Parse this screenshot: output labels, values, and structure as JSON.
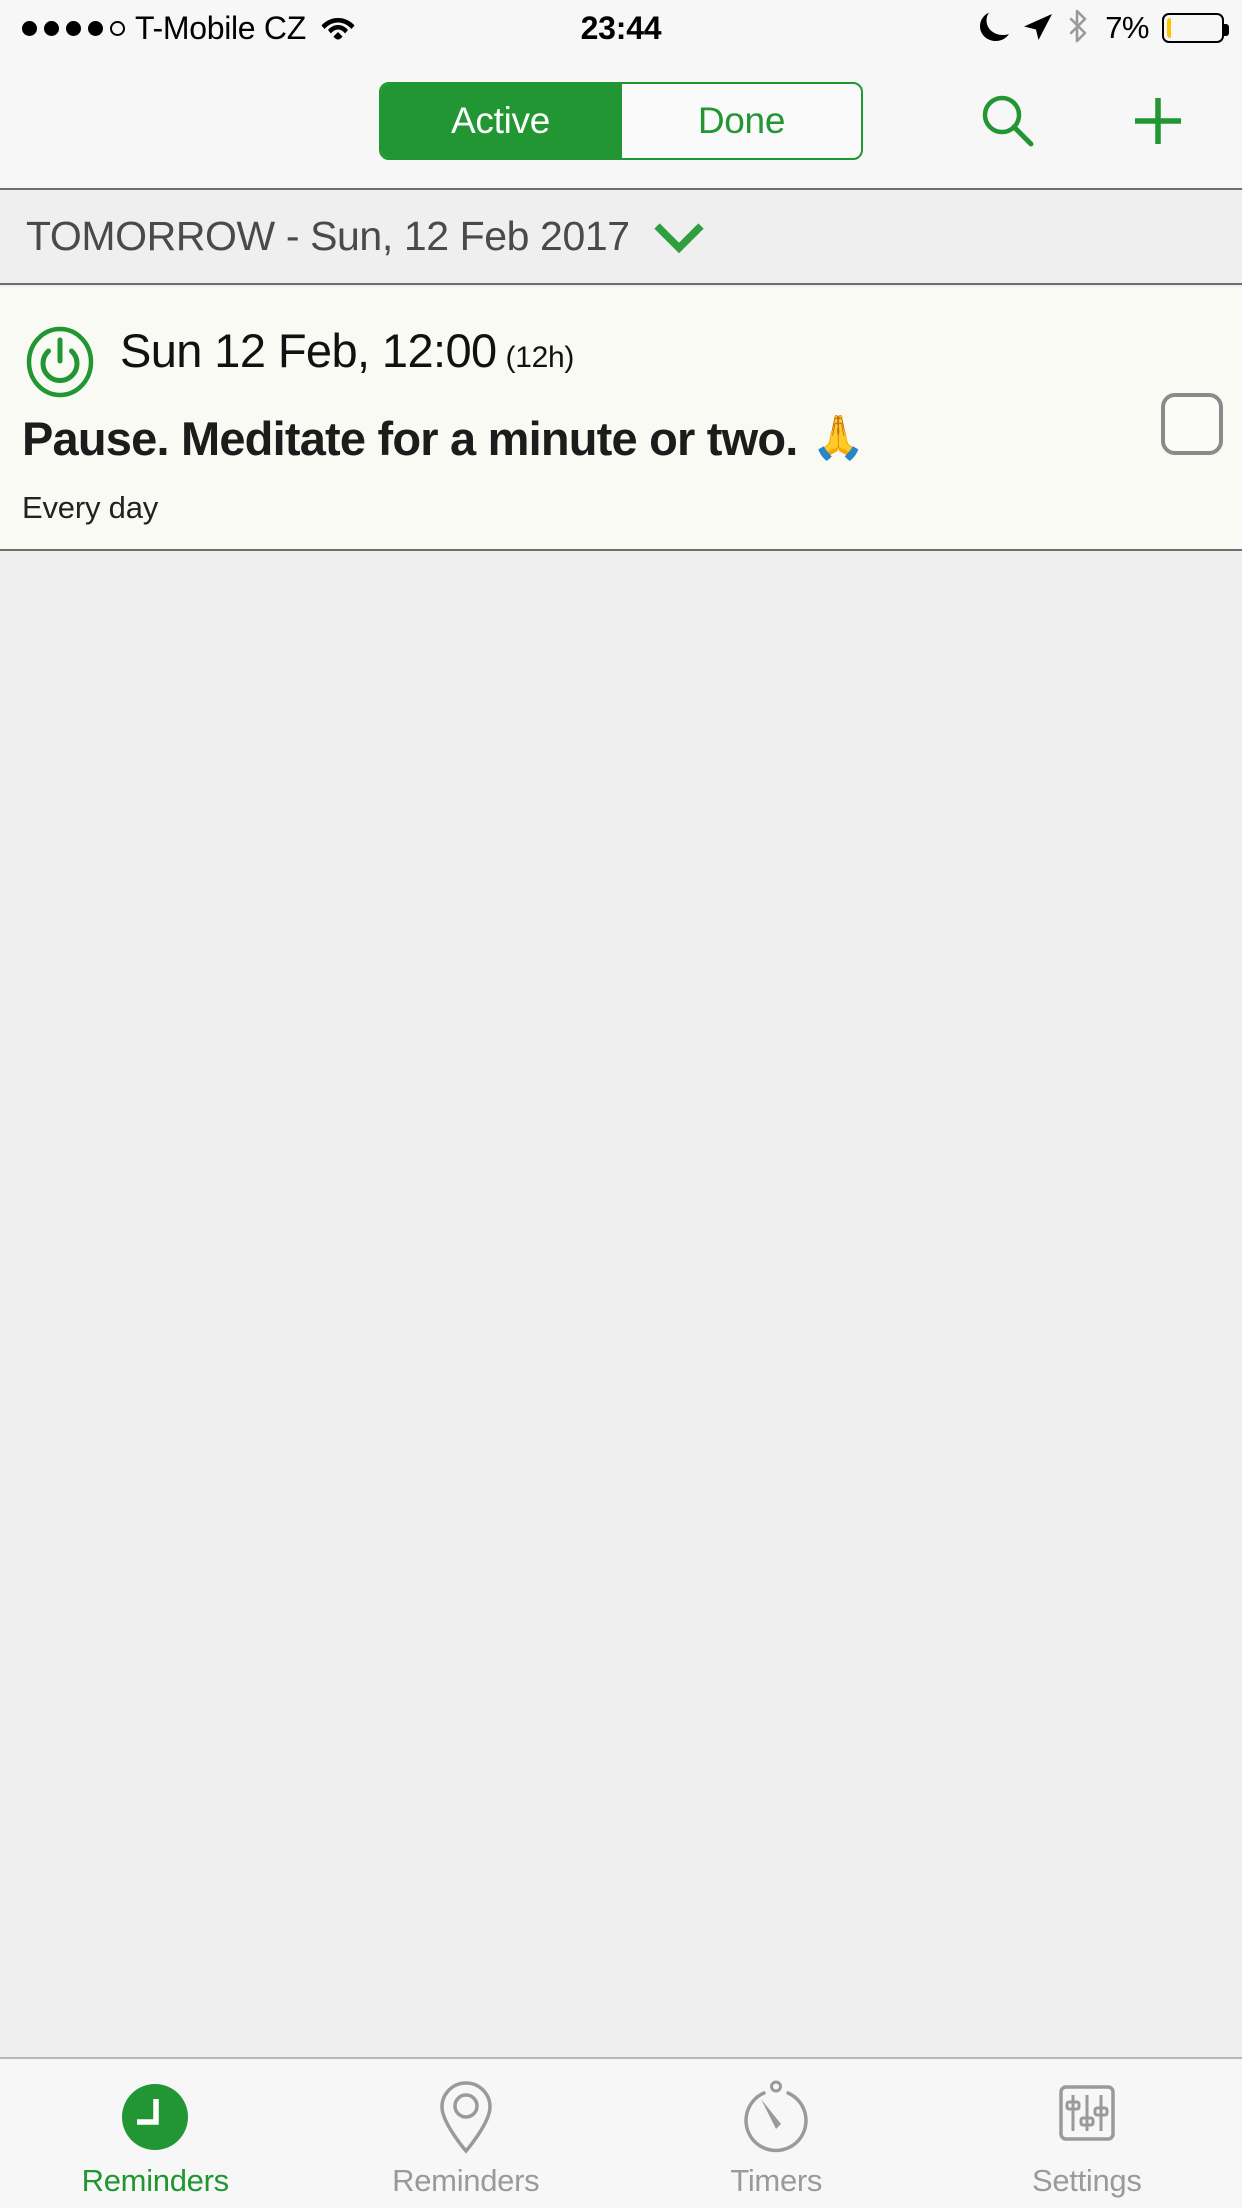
{
  "status_bar": {
    "signal_dots_filled": 4,
    "signal_dots_total": 5,
    "carrier": "T-Mobile CZ",
    "wifi_icon": "wifi-icon",
    "time": "23:44",
    "do_not_disturb_icon": "moon-icon",
    "location_icon": "location-arrow-icon",
    "bluetooth_icon": "bluetooth-icon",
    "battery_percent": "7%",
    "battery_level": 7,
    "battery_color": "#FFC400"
  },
  "navbar": {
    "segments": [
      {
        "label": "Active",
        "selected": true
      },
      {
        "label": "Done",
        "selected": false
      }
    ],
    "search_icon": "search-icon",
    "add_icon": "plus-icon",
    "accent_color": "#219632"
  },
  "date_header": {
    "title": "TOMORROW - Sun, 12 Feb 2017",
    "chevron_icon": "chevron-down-icon",
    "chevron_color": "#219632"
  },
  "reminder": {
    "status_icon": "power-icon",
    "status_icon_color": "#219632",
    "time": "Sun 12 Feb, 12:00",
    "duration": "(12h)",
    "title": "Pause. Meditate for a minute or two.",
    "emoji": "🙏",
    "repeat": "Every day",
    "completed": false,
    "card_background": "#F8FAF3"
  },
  "tabbar": {
    "tabs": [
      {
        "label": "Reminders",
        "icon": "clock-icon",
        "active": true
      },
      {
        "label": "Reminders",
        "icon": "location-pin-icon",
        "active": false
      },
      {
        "label": "Timers",
        "icon": "stopwatch-icon",
        "active": false
      },
      {
        "label": "Settings",
        "icon": "sliders-icon",
        "active": false
      }
    ],
    "active_color": "#219632",
    "inactive_color": "#9A9A9A"
  }
}
